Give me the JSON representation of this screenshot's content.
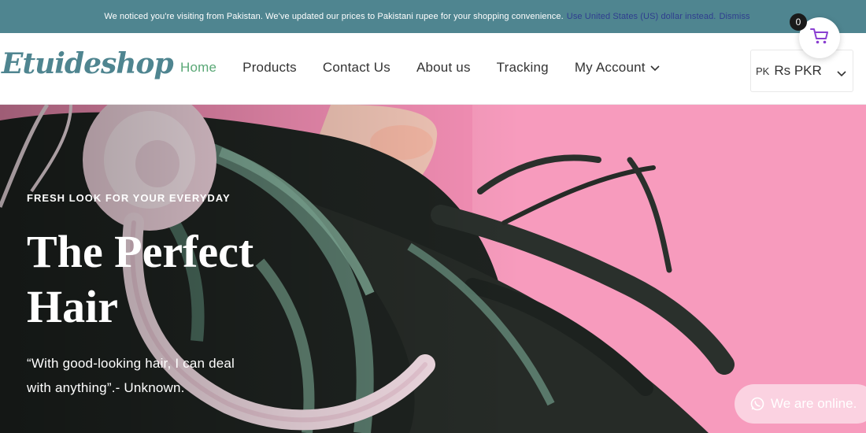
{
  "notice": {
    "message": "We noticed you're visiting from Pakistan. We've updated our prices to Pakistani rupee for your shopping convenience.",
    "switch_link": "Use United States (US) dollar instead.",
    "dismiss": "Dismiss"
  },
  "header": {
    "logo": "Etuideshop",
    "nav": [
      {
        "label": "Home",
        "active": true
      },
      {
        "label": "Products"
      },
      {
        "label": "Contact Us"
      },
      {
        "label": "About us"
      },
      {
        "label": "Tracking"
      },
      {
        "label": "My Account",
        "has_dropdown": true
      }
    ],
    "currency": {
      "country_code": "PK",
      "selected": "Rs PKR"
    },
    "cart": {
      "count": "0",
      "icon": "cart-icon"
    }
  },
  "hero": {
    "kicker": "FRESH LOOK FOR YOUR EVERYDAY",
    "title_line1": "The Perfect",
    "title_line2": "Hair",
    "quote_line1": "“With good-looking hair, I can deal",
    "quote_line2": "with anything”.- Unknown."
  },
  "chat": {
    "label": "We are online.",
    "icon": "whatsapp-icon"
  },
  "colors": {
    "notice_bg": "#4f8590",
    "accent_green": "#5aa876",
    "cart_purple": "#8a3fd1",
    "hero_pink": "#f28eb2"
  }
}
